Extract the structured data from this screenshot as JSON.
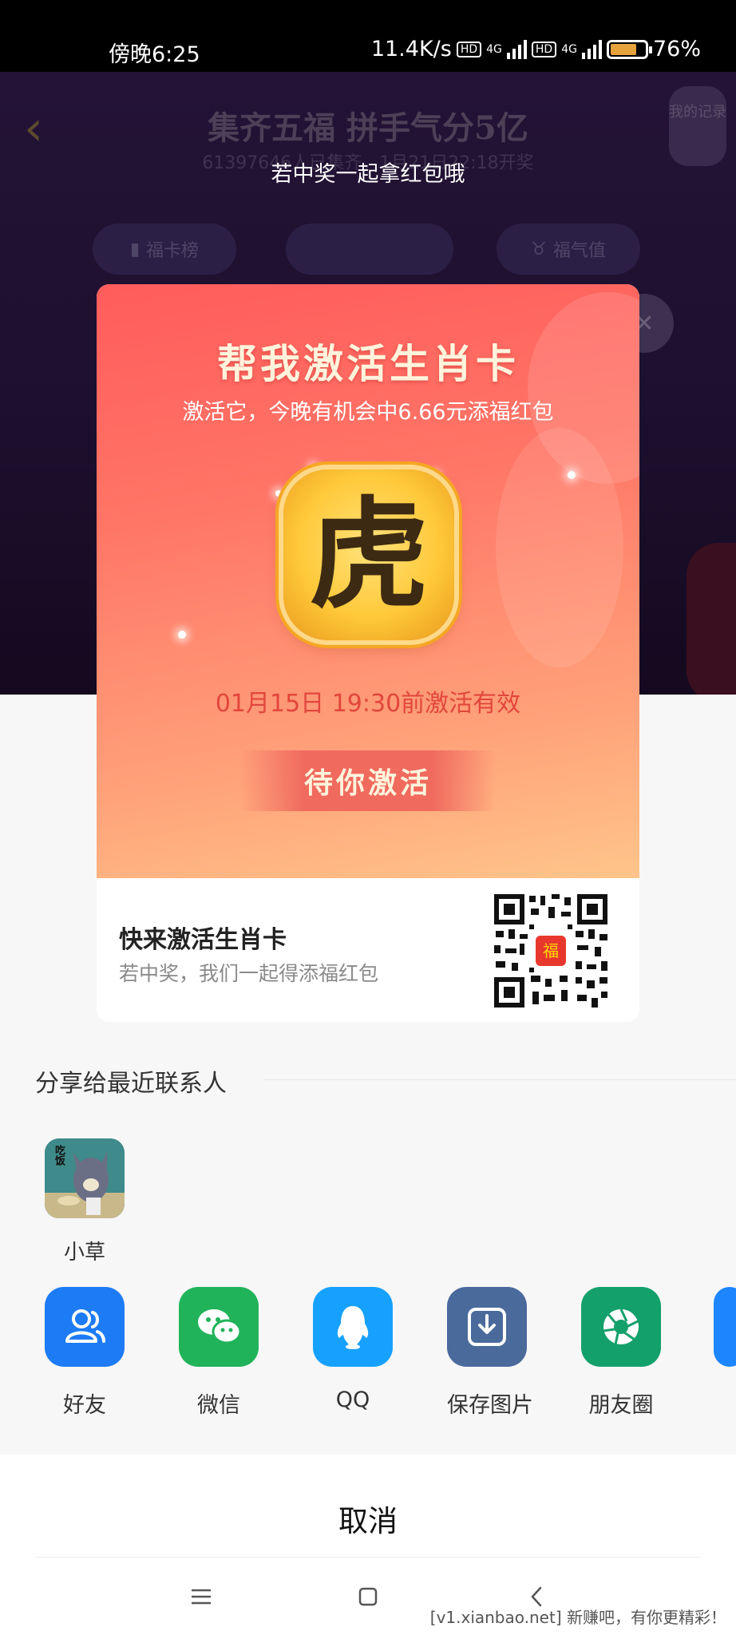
{
  "status_bar": {
    "time": "傍晚6:25",
    "net_speed": "11.4K/s",
    "hd1": "HD",
    "net1": "4G",
    "hd2": "HD",
    "net2": "4G",
    "battery": "76%",
    "battery_level": 0.76
  },
  "background_page": {
    "title": "集齐五福 拼手气分5亿",
    "subtitle": "61397646人已集齐，1月21日22:18开奖",
    "corner_label": "我的记录",
    "tabs": [
      "福卡榜",
      "",
      "福气值"
    ],
    "hint": "若中奖一起拿红包哦"
  },
  "card": {
    "heading": "帮我激活生肖卡",
    "subheading": "激活它，今晚有机会中6.66元添福红包",
    "zodiac_char": "虎",
    "valid_until": "01月15日 19:30前激活有效",
    "button_label": "待你激活",
    "footer_title": "快来激活生肖卡",
    "footer_sub": "若中奖，我们一起得添福红包",
    "qr_badge": "福"
  },
  "share": {
    "section_title": "分享给最近联系人",
    "contacts": [
      {
        "name": "小草",
        "avatar_text": "吃饭"
      }
    ],
    "apps": [
      {
        "label": "好友",
        "icon": "friends-icon",
        "color": "#1d7bf5"
      },
      {
        "label": "微信",
        "icon": "wechat-icon",
        "color": "#21b35a"
      },
      {
        "label": "QQ",
        "icon": "qq-penguin-icon",
        "color": "#17a1ff"
      },
      {
        "label": "保存图片",
        "icon": "download-icon",
        "color": "#4a6a9c"
      },
      {
        "label": "朋友圈",
        "icon": "moments-icon",
        "color": "#14a06b"
      }
    ],
    "cancel_label": "取消"
  },
  "watermark": "[v1.xianbao.net] 新赚吧，有你更精彩！"
}
